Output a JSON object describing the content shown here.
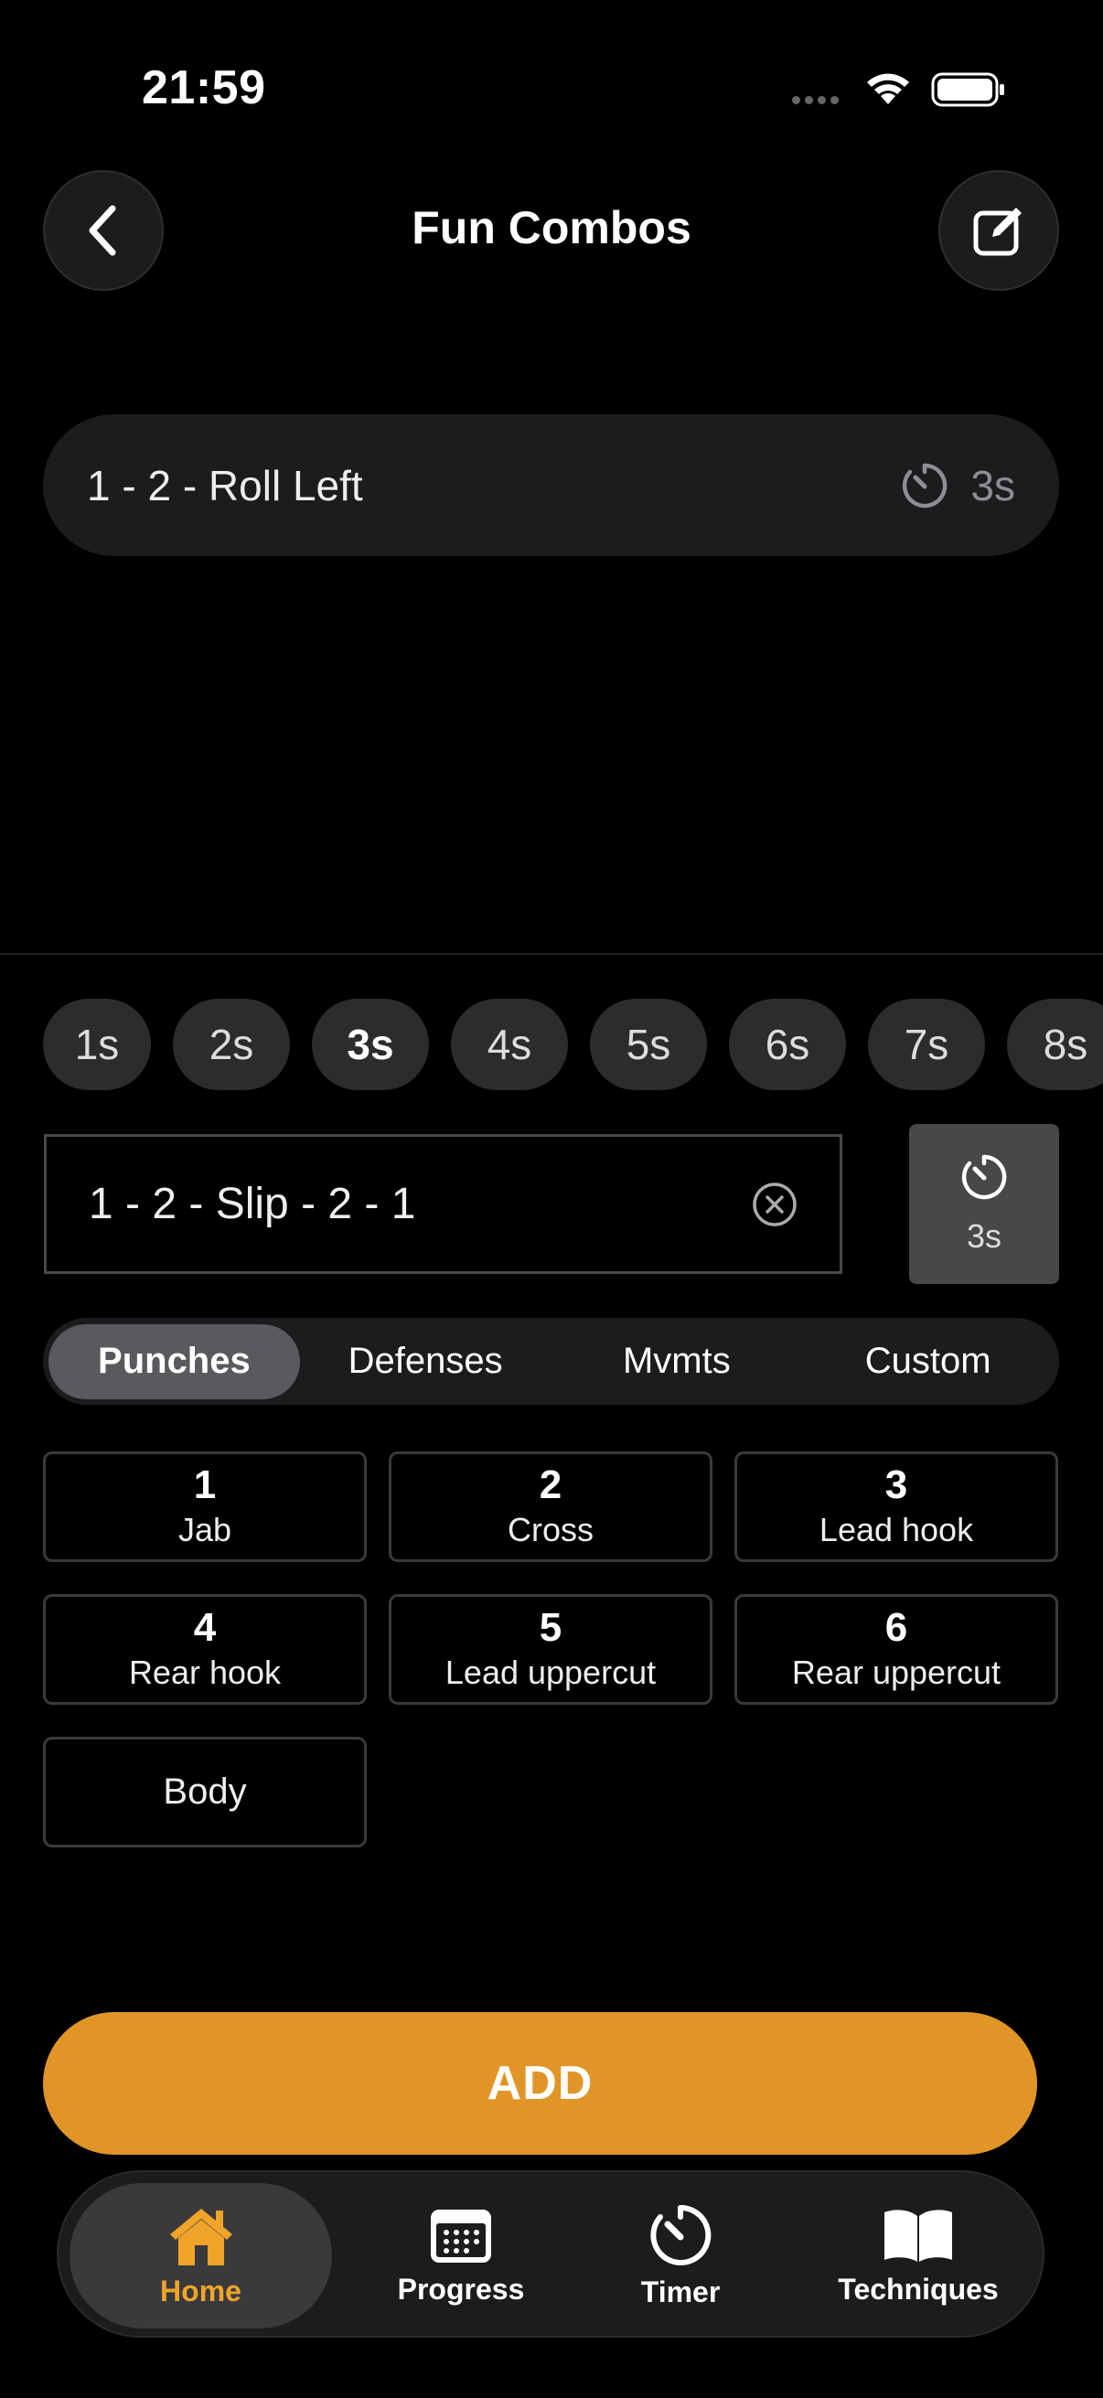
{
  "status": {
    "time": "21:59"
  },
  "header": {
    "title": "Fun Combos"
  },
  "combos": [
    {
      "text": "1 - 2 - Roll Left",
      "duration": "3s"
    }
  ],
  "durations": [
    "1s",
    "2s",
    "3s",
    "4s",
    "5s",
    "6s",
    "7s",
    "8s"
  ],
  "selected_duration": "3s",
  "input": {
    "value": "1 - 2 - Slip - 2 - 1",
    "timer_label": "3s"
  },
  "categories": [
    "Punches",
    "Defenses",
    "Mvmts",
    "Custom"
  ],
  "active_category": "Punches",
  "moves": [
    {
      "num": "1",
      "name": "Jab"
    },
    {
      "num": "2",
      "name": "Cross"
    },
    {
      "num": "3",
      "name": "Lead hook"
    },
    {
      "num": "4",
      "name": "Rear hook"
    },
    {
      "num": "5",
      "name": "Lead uppercut"
    },
    {
      "num": "6",
      "name": "Rear uppercut"
    },
    {
      "num": "",
      "name": "Body"
    }
  ],
  "add_label": "ADD",
  "tabbar": [
    {
      "label": "Home",
      "icon": "house-icon",
      "active": true
    },
    {
      "label": "Progress",
      "icon": "calendar-icon"
    },
    {
      "label": "Timer",
      "icon": "timer-icon"
    },
    {
      "label": "Techniques",
      "icon": "book-icon"
    }
  ],
  "colors": {
    "accent": "#e29527",
    "tab_active": "#f0a42a",
    "background": "#000000",
    "card": "#1c1c1e"
  }
}
